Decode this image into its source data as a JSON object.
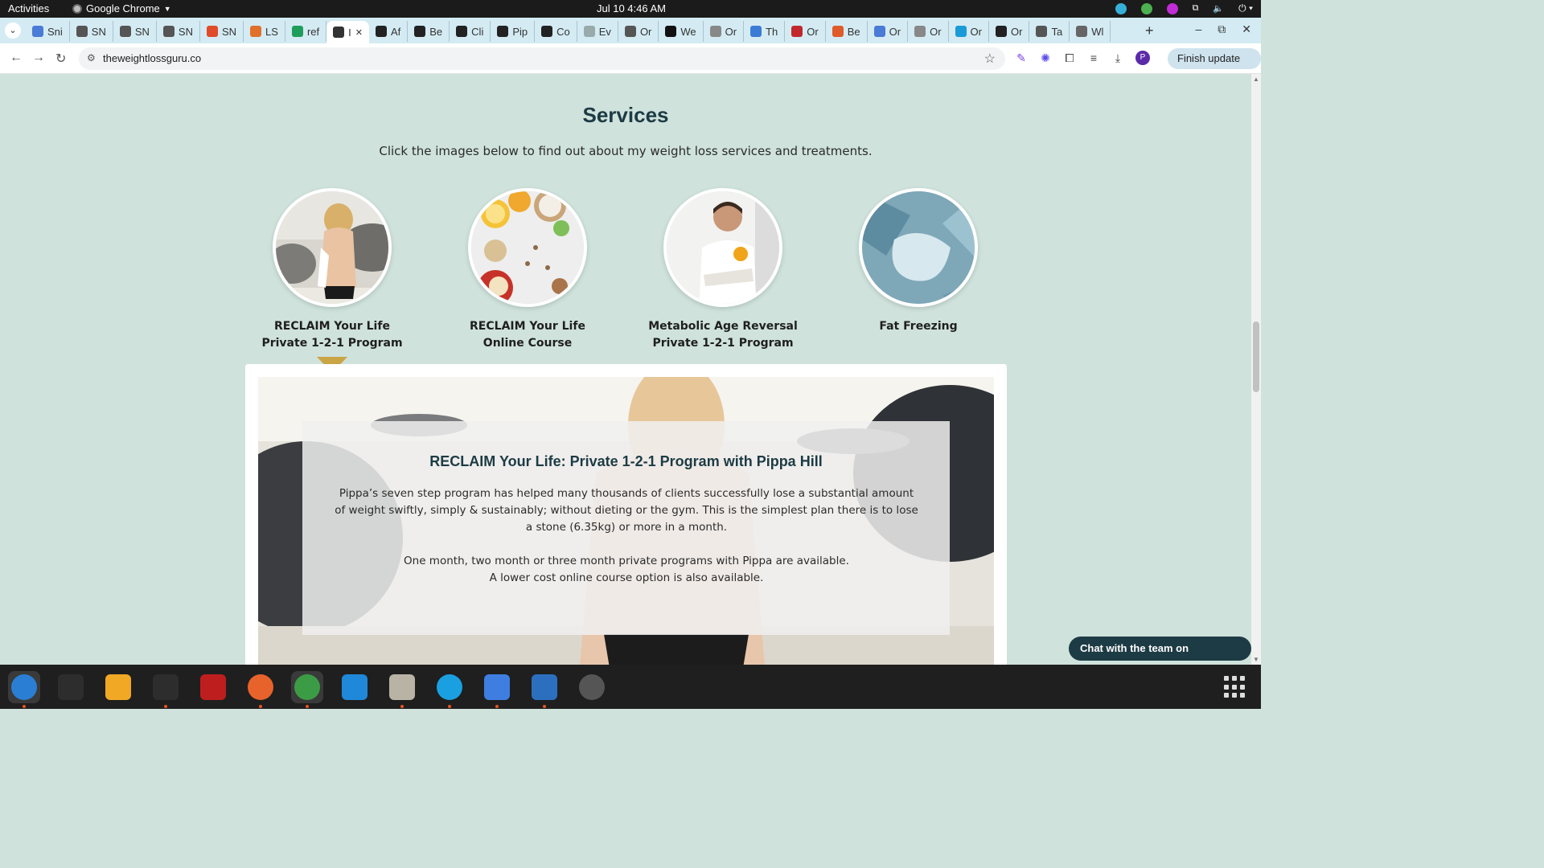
{
  "topbar": {
    "activities": "Activities",
    "app_name": "Google Chrome",
    "clock": "Jul 10  4:46 AM"
  },
  "tabs": [
    {
      "label": "Sni",
      "icon": "docs-icon",
      "color": "#4a7bd6"
    },
    {
      "label": "SN",
      "icon": "snp-icon",
      "color": "#555"
    },
    {
      "label": "SN",
      "icon": "snp-icon",
      "color": "#555"
    },
    {
      "label": "SN",
      "icon": "snp-icon",
      "color": "#555"
    },
    {
      "label": "SN",
      "icon": "flame-icon",
      "color": "#e04b2a"
    },
    {
      "label": "LS",
      "icon": "ls-icon",
      "color": "#e0702a"
    },
    {
      "label": "ref",
      "icon": "sheets-plus-icon",
      "color": "#1e9e5a"
    },
    {
      "label": "I",
      "icon": "audio-icon",
      "color": "#333",
      "active": true
    },
    {
      "label": "Af",
      "icon": "info-icon",
      "color": "#222"
    },
    {
      "label": "Be",
      "icon": "info-icon",
      "color": "#222"
    },
    {
      "label": "Cli",
      "icon": "info-icon",
      "color": "#222"
    },
    {
      "label": "Pip",
      "icon": "info-icon",
      "color": "#222"
    },
    {
      "label": "Co",
      "icon": "info-icon",
      "color": "#222"
    },
    {
      "label": "Ev",
      "icon": "cloud-icon",
      "color": "#9aa"
    },
    {
      "label": "Or",
      "icon": "globe-icon",
      "color": "#555"
    },
    {
      "label": "We",
      "icon": "u-icon",
      "color": "#111"
    },
    {
      "label": "Or",
      "icon": "chart-icon",
      "color": "#888"
    },
    {
      "label": "Th",
      "icon": "grid-icon",
      "color": "#3a7bd5"
    },
    {
      "label": "Or",
      "icon": "red-icon",
      "color": "#c0282d"
    },
    {
      "label": "Be",
      "icon": "code-icon",
      "color": "#e05a2a"
    },
    {
      "label": "Or",
      "icon": "run-icon",
      "color": "#4a7bd6"
    },
    {
      "label": "Or",
      "icon": "ghost-icon",
      "color": "#888"
    },
    {
      "label": "Or",
      "icon": "bubble-icon",
      "color": "#1a9bd7"
    },
    {
      "label": "Or",
      "icon": "dark-icon",
      "color": "#222"
    },
    {
      "label": "Ta",
      "icon": "globe-icon",
      "color": "#555"
    },
    {
      "label": "Wl",
      "icon": "card-icon",
      "color": "#666"
    }
  ],
  "window_controls": {
    "minimize": "–",
    "restore": "⧉",
    "close": "✕"
  },
  "toolbar": {
    "url": "theweightlossguru.co",
    "finish_update": "Finish update",
    "profile_initial": "P"
  },
  "content": {
    "services_title": "Services",
    "services_sub": "Click the images below to find out about my weight loss services and treatments.",
    "services": [
      {
        "line1": "RECLAIM Your Life",
        "line2": "Private 1-2-1 Program",
        "image": "woman-beach"
      },
      {
        "line1": "RECLAIM Your Life",
        "line2": "Online Course",
        "image": "healthy-food"
      },
      {
        "line1": "Metabolic Age Reversal",
        "line2": "Private 1-2-1 Program",
        "image": "man-smiling"
      },
      {
        "line1": "Fat Freezing",
        "line2": "",
        "image": "ice"
      }
    ],
    "panel": {
      "title": "RECLAIM Your Life: Private 1-2-1 Program with Pippa Hill",
      "para1": "Pippa’s seven step program has helped many thousands of clients successfully lose a substantial amount of weight swiftly, simply & sustainably; without dieting or the gym. This is the simplest plan there is to lose a stone (6.35kg) or more in a month.",
      "para2a": "One month, two month or three month private programs with Pippa are available.",
      "para2b": "A lower cost online course option is also available."
    },
    "whatsapp": "Chat with the team on Whatsapp"
  },
  "colors": {
    "page_bg": "#cfe2dc",
    "heading": "#1d3b44",
    "pointer": "#c9a545",
    "whatsapp_bg": "#1d3b44"
  },
  "dock": [
    {
      "name": "thunderbird-icon",
      "color": "#2a7fd4"
    },
    {
      "name": "terminal-icon",
      "color": "#2d2d2d"
    },
    {
      "name": "calculator-icon",
      "color": "#f0a825"
    },
    {
      "name": "system-monitor-icon",
      "color": "#2d2d2d"
    },
    {
      "name": "filezilla-icon",
      "color": "#bf1e1e"
    },
    {
      "name": "firefox-icon",
      "color": "#e8632b"
    },
    {
      "name": "chrome-icon",
      "color": "#3c9c46"
    },
    {
      "name": "vscode-icon",
      "color": "#1f88d8"
    },
    {
      "name": "files-icon",
      "color": "#b9b3a6"
    },
    {
      "name": "skype-icon",
      "color": "#1aa0e1"
    },
    {
      "name": "text-editor-icon",
      "color": "#3e7ee0"
    },
    {
      "name": "writer-icon",
      "color": "#2d6fbf"
    },
    {
      "name": "optical-disc-icon",
      "color": "#555"
    }
  ]
}
